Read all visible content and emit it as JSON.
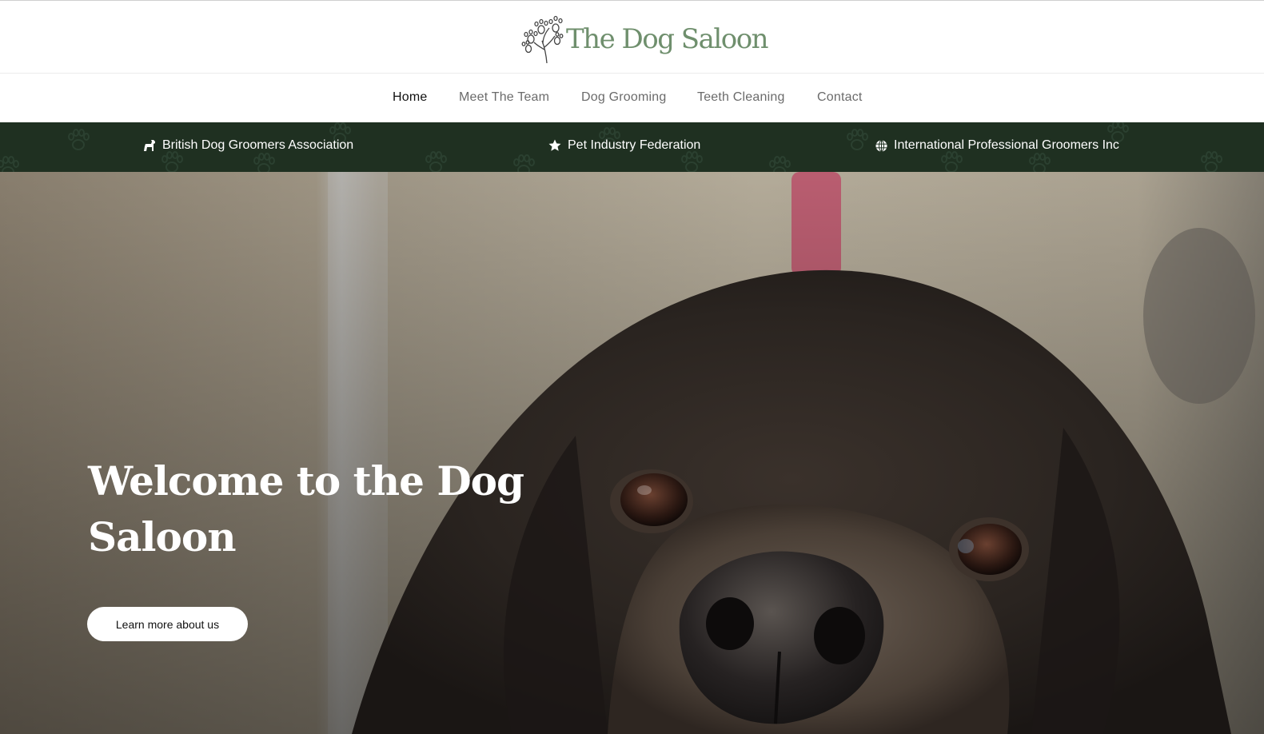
{
  "logo": {
    "text": "The Dog Saloon",
    "icon": "paw-tree-icon",
    "color": "#6f8f6d"
  },
  "nav": {
    "items": [
      {
        "label": "Home",
        "active": true
      },
      {
        "label": "Meet The Team",
        "active": false
      },
      {
        "label": "Dog Grooming",
        "active": false
      },
      {
        "label": "Teeth Cleaning",
        "active": false
      },
      {
        "label": "Contact",
        "active": false
      }
    ]
  },
  "associations": {
    "background": "#1f3021",
    "items": [
      {
        "icon": "dog-icon",
        "label": "British Dog Groomers Association"
      },
      {
        "icon": "star-icon",
        "label": "Pet Industry Federation"
      },
      {
        "icon": "globe-icon",
        "label": "International Professional Groomers Inc"
      }
    ]
  },
  "hero": {
    "title": "Welcome to the Dog Saloon",
    "button_label": "Learn more about us",
    "image": "close-up photo of a black spaniel dog's face"
  }
}
